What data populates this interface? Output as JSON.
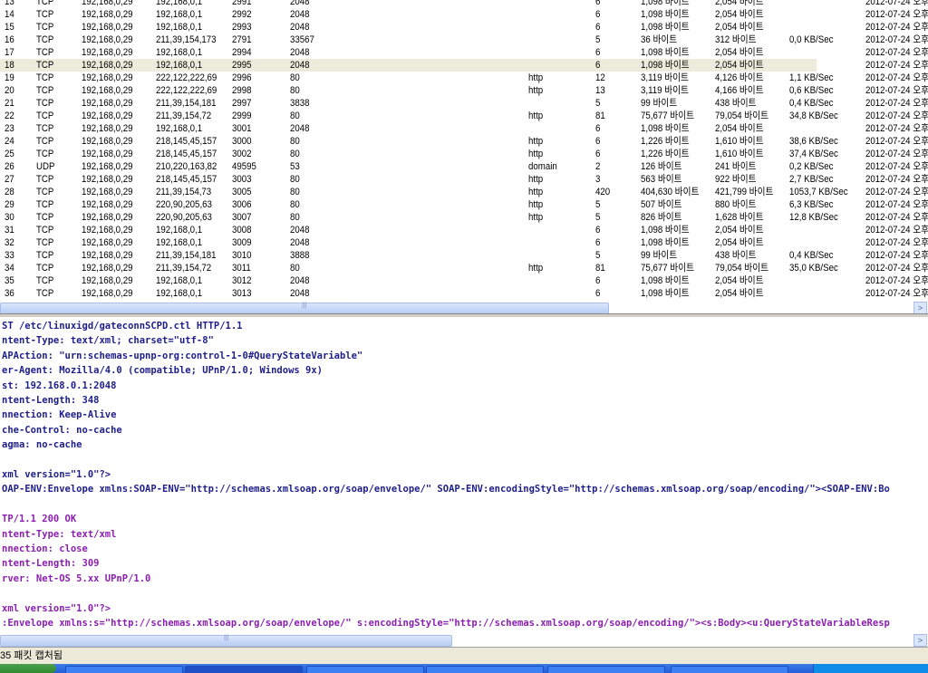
{
  "connections": [
    [
      "13",
      "TCP",
      "192,168,0,29",
      "192,168,0,1",
      "2991",
      "2048",
      "",
      "6",
      "1,098 바이트",
      "2,054 바이트",
      "",
      "2012-07-24 오후"
    ],
    [
      "14",
      "TCP",
      "192,168,0,29",
      "192,168,0,1",
      "2992",
      "2048",
      "",
      "6",
      "1,098 바이트",
      "2,054 바이트",
      "",
      "2012-07-24 오후"
    ],
    [
      "15",
      "TCP",
      "192,168,0,29",
      "192,168,0,1",
      "2993",
      "2048",
      "",
      "6",
      "1,098 바이트",
      "2,054 바이트",
      "",
      "2012-07-24 오후"
    ],
    [
      "16",
      "TCP",
      "192,168,0,29",
      "211,39,154,173",
      "2791",
      "33567",
      "",
      "5",
      "36 바이트",
      "312 바이트",
      "0,0 KB/Sec",
      "2012-07-24 오후"
    ],
    [
      "17",
      "TCP",
      "192,168,0,29",
      "192,168,0,1",
      "2994",
      "2048",
      "",
      "6",
      "1,098 바이트",
      "2,054 바이트",
      "",
      "2012-07-24 오후"
    ],
    [
      "18",
      "TCP",
      "192,168,0,29",
      "192,168,0,1",
      "2995",
      "2048",
      "",
      "6",
      "1,098 바이트",
      "2,054 바이트",
      "",
      "2012-07-24 오후"
    ],
    [
      "19",
      "TCP",
      "192,168,0,29",
      "222,122,222,69",
      "2996",
      "80",
      "http",
      "12",
      "3,119 바이트",
      "4,126 바이트",
      "1,1 KB/Sec",
      "2012-07-24 오후"
    ],
    [
      "20",
      "TCP",
      "192,168,0,29",
      "222,122,222,69",
      "2998",
      "80",
      "http",
      "13",
      "3,119 바이트",
      "4,166 바이트",
      "0,6 KB/Sec",
      "2012-07-24 오후"
    ],
    [
      "21",
      "TCP",
      "192,168,0,29",
      "211,39,154,181",
      "2997",
      "3838",
      "",
      "5",
      "99 바이트",
      "438 바이트",
      "0,4 KB/Sec",
      "2012-07-24 오후"
    ],
    [
      "22",
      "TCP",
      "192,168,0,29",
      "211,39,154,72",
      "2999",
      "80",
      "http",
      "81",
      "75,677 바이트",
      "79,054 바이트",
      "34,8 KB/Sec",
      "2012-07-24 오후"
    ],
    [
      "23",
      "TCP",
      "192,168,0,29",
      "192,168,0,1",
      "3001",
      "2048",
      "",
      "6",
      "1,098 바이트",
      "2,054 바이트",
      "",
      "2012-07-24 오후"
    ],
    [
      "24",
      "TCP",
      "192,168,0,29",
      "218,145,45,157",
      "3000",
      "80",
      "http",
      "6",
      "1,226 바이트",
      "1,610 바이트",
      "38,6 KB/Sec",
      "2012-07-24 오후"
    ],
    [
      "25",
      "TCP",
      "192,168,0,29",
      "218,145,45,157",
      "3002",
      "80",
      "http",
      "6",
      "1,226 바이트",
      "1,610 바이트",
      "37,4 KB/Sec",
      "2012-07-24 오후"
    ],
    [
      "26",
      "UDP",
      "192,168,0,29",
      "210,220,163,82",
      "49595",
      "53",
      "domain",
      "2",
      "126 바이트",
      "241 바이트",
      "0,2 KB/Sec",
      "2012-07-24 오후"
    ],
    [
      "27",
      "TCP",
      "192,168,0,29",
      "218,145,45,157",
      "3003",
      "80",
      "http",
      "3",
      "563 바이트",
      "922 바이트",
      "2,7 KB/Sec",
      "2012-07-24 오후"
    ],
    [
      "28",
      "TCP",
      "192,168,0,29",
      "211,39,154,73",
      "3005",
      "80",
      "http",
      "420",
      "404,630 바이트",
      "421,799 바이트",
      "1053,7 KB/Sec",
      "2012-07-24 오후"
    ],
    [
      "29",
      "TCP",
      "192,168,0,29",
      "220,90,205,63",
      "3006",
      "80",
      "http",
      "5",
      "507 바이트",
      "880 바이트",
      "6,3 KB/Sec",
      "2012-07-24 오후"
    ],
    [
      "30",
      "TCP",
      "192,168,0,29",
      "220,90,205,63",
      "3007",
      "80",
      "http",
      "5",
      "826 바이트",
      "1,628 바이트",
      "12,8 KB/Sec",
      "2012-07-24 오후"
    ],
    [
      "31",
      "TCP",
      "192,168,0,29",
      "192,168,0,1",
      "3008",
      "2048",
      "",
      "6",
      "1,098 바이트",
      "2,054 바이트",
      "",
      "2012-07-24 오후"
    ],
    [
      "32",
      "TCP",
      "192,168,0,29",
      "192,168,0,1",
      "3009",
      "2048",
      "",
      "6",
      "1,098 바이트",
      "2,054 바이트",
      "",
      "2012-07-24 오후"
    ],
    [
      "33",
      "TCP",
      "192,168,0,29",
      "211,39,154,181",
      "3010",
      "3888",
      "",
      "5",
      "99 바이트",
      "438 바이트",
      "0,4 KB/Sec",
      "2012-07-24 오후"
    ],
    [
      "34",
      "TCP",
      "192,168,0,29",
      "211,39,154,72",
      "3011",
      "80",
      "http",
      "81",
      "75,677 바이트",
      "79,054 바이트",
      "35,0 KB/Sec",
      "2012-07-24 오후"
    ],
    [
      "35",
      "TCP",
      "192,168,0,29",
      "192,168,0,1",
      "3012",
      "2048",
      "",
      "6",
      "1,098 바이트",
      "2,054 바이트",
      "",
      "2012-07-24 오후"
    ],
    [
      "36",
      "TCP",
      "192,168,0,29",
      "192,168,0,1",
      "3013",
      "2048",
      "",
      "6",
      "1,098 바이트",
      "2,054 바이트",
      "",
      "2012-07-24 오후"
    ]
  ],
  "selected_row": "18",
  "payload": [
    {
      "t": "ST /etc/linuxigd/gateconnSCPD.ctl HTTP/1.1",
      "k": "req"
    },
    {
      "t": "ntent-Type: text/xml; charset=\"utf-8\"",
      "k": "req"
    },
    {
      "t": "APAction: \"urn:schemas-upnp-org:control-1-0#QueryStateVariable\"",
      "k": "req"
    },
    {
      "t": "er-Agent: Mozilla/4.0 (compatible; UPnP/1.0; Windows 9x)",
      "k": "req"
    },
    {
      "t": "st: 192.168.0.1:2048",
      "k": "req"
    },
    {
      "t": "ntent-Length: 348",
      "k": "req"
    },
    {
      "t": "nnection: Keep-Alive",
      "k": "req"
    },
    {
      "t": "che-Control: no-cache",
      "k": "req"
    },
    {
      "t": "agma: no-cache",
      "k": "req"
    },
    {
      "t": "",
      "k": "req"
    },
    {
      "t": "xml version=\"1.0\"?>",
      "k": "req"
    },
    {
      "t": "OAP-ENV:Envelope xmlns:SOAP-ENV=\"http://schemas.xmlsoap.org/soap/envelope/\" SOAP-ENV:encodingStyle=\"http://schemas.xmlsoap.org/soap/encoding/\"><SOAP-ENV:Bo",
      "k": "req"
    },
    {
      "t": "",
      "k": "res"
    },
    {
      "t": "TP/1.1 200 OK",
      "k": "res"
    },
    {
      "t": "ntent-Type: text/xml",
      "k": "res"
    },
    {
      "t": "nnection: close",
      "k": "res"
    },
    {
      "t": "ntent-Length: 309",
      "k": "res"
    },
    {
      "t": "rver: Net-OS 5.xx UPnP/1.0",
      "k": "res"
    },
    {
      "t": "",
      "k": "res"
    },
    {
      "t": "xml version=\"1.0\"?>",
      "k": "res"
    },
    {
      "t": ":Envelope xmlns:s=\"http://schemas.xmlsoap.org/soap/envelope/\" s:encodingStyle=\"http://schemas.xmlsoap.org/soap/encoding/\"><s:Body><u:QueryStateVariableResp",
      "k": "res"
    }
  ],
  "status": {
    "text": "35 패킷 캡처됨"
  },
  "scroll_arrow": ">"
}
